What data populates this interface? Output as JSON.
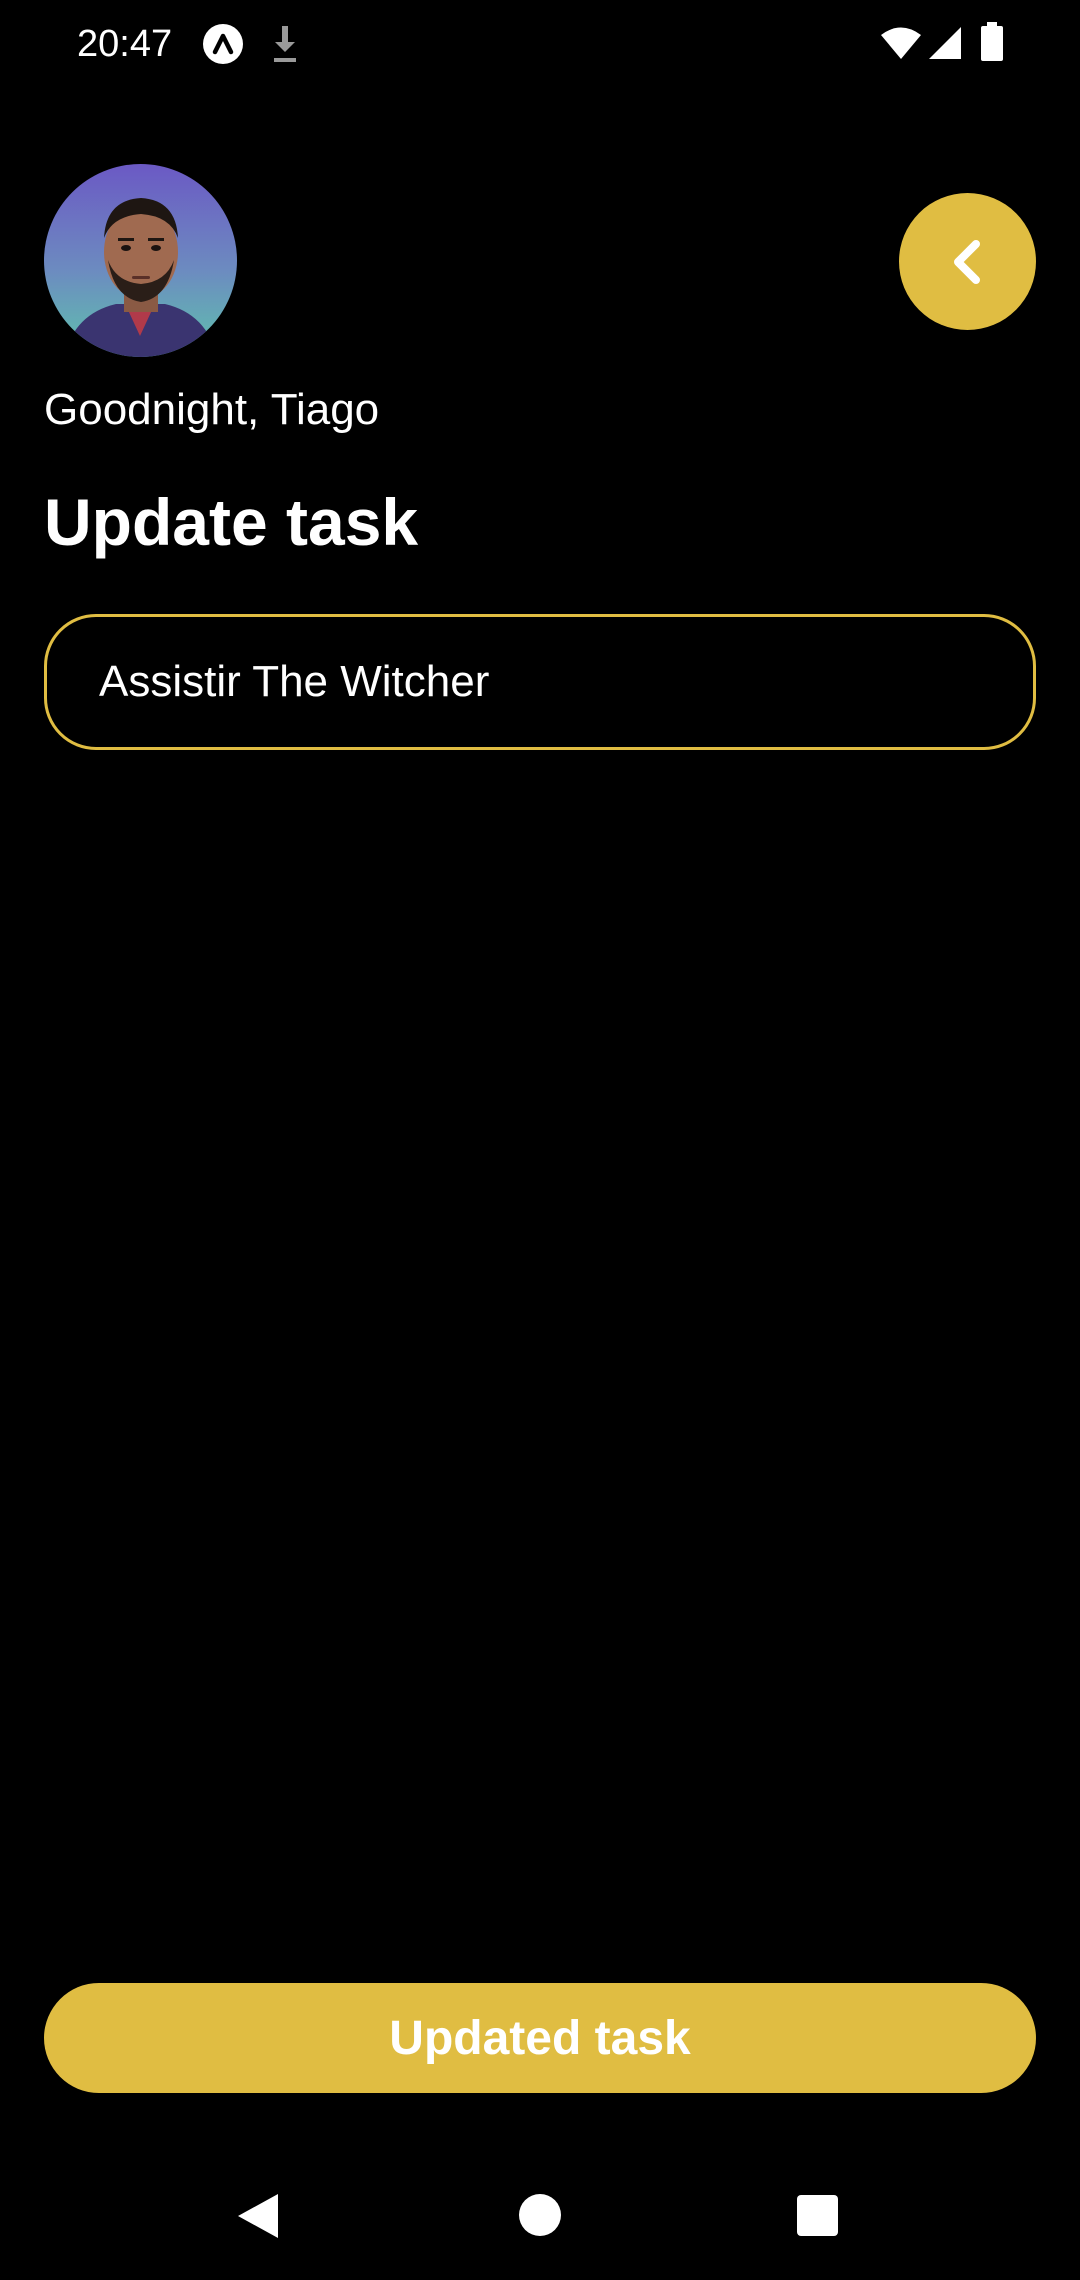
{
  "status_bar": {
    "time": "20:47",
    "icons": [
      "app-notification-icon",
      "download-icon",
      "wifi-icon",
      "cell-signal-icon",
      "battery-icon"
    ]
  },
  "header": {
    "greeting": "Goodnight, Tiago",
    "back_icon": "chevron-left-icon"
  },
  "main": {
    "title": "Update task",
    "task_input": {
      "value": "Assistir The Witcher"
    },
    "submit_label": "Updated task"
  },
  "nav_bar": {
    "icons": [
      "nav-back-icon",
      "nav-home-icon",
      "nav-recents-icon"
    ]
  },
  "colors": {
    "background": "#000000",
    "accent": "#E0BD42",
    "text": "#FFFFFF"
  }
}
